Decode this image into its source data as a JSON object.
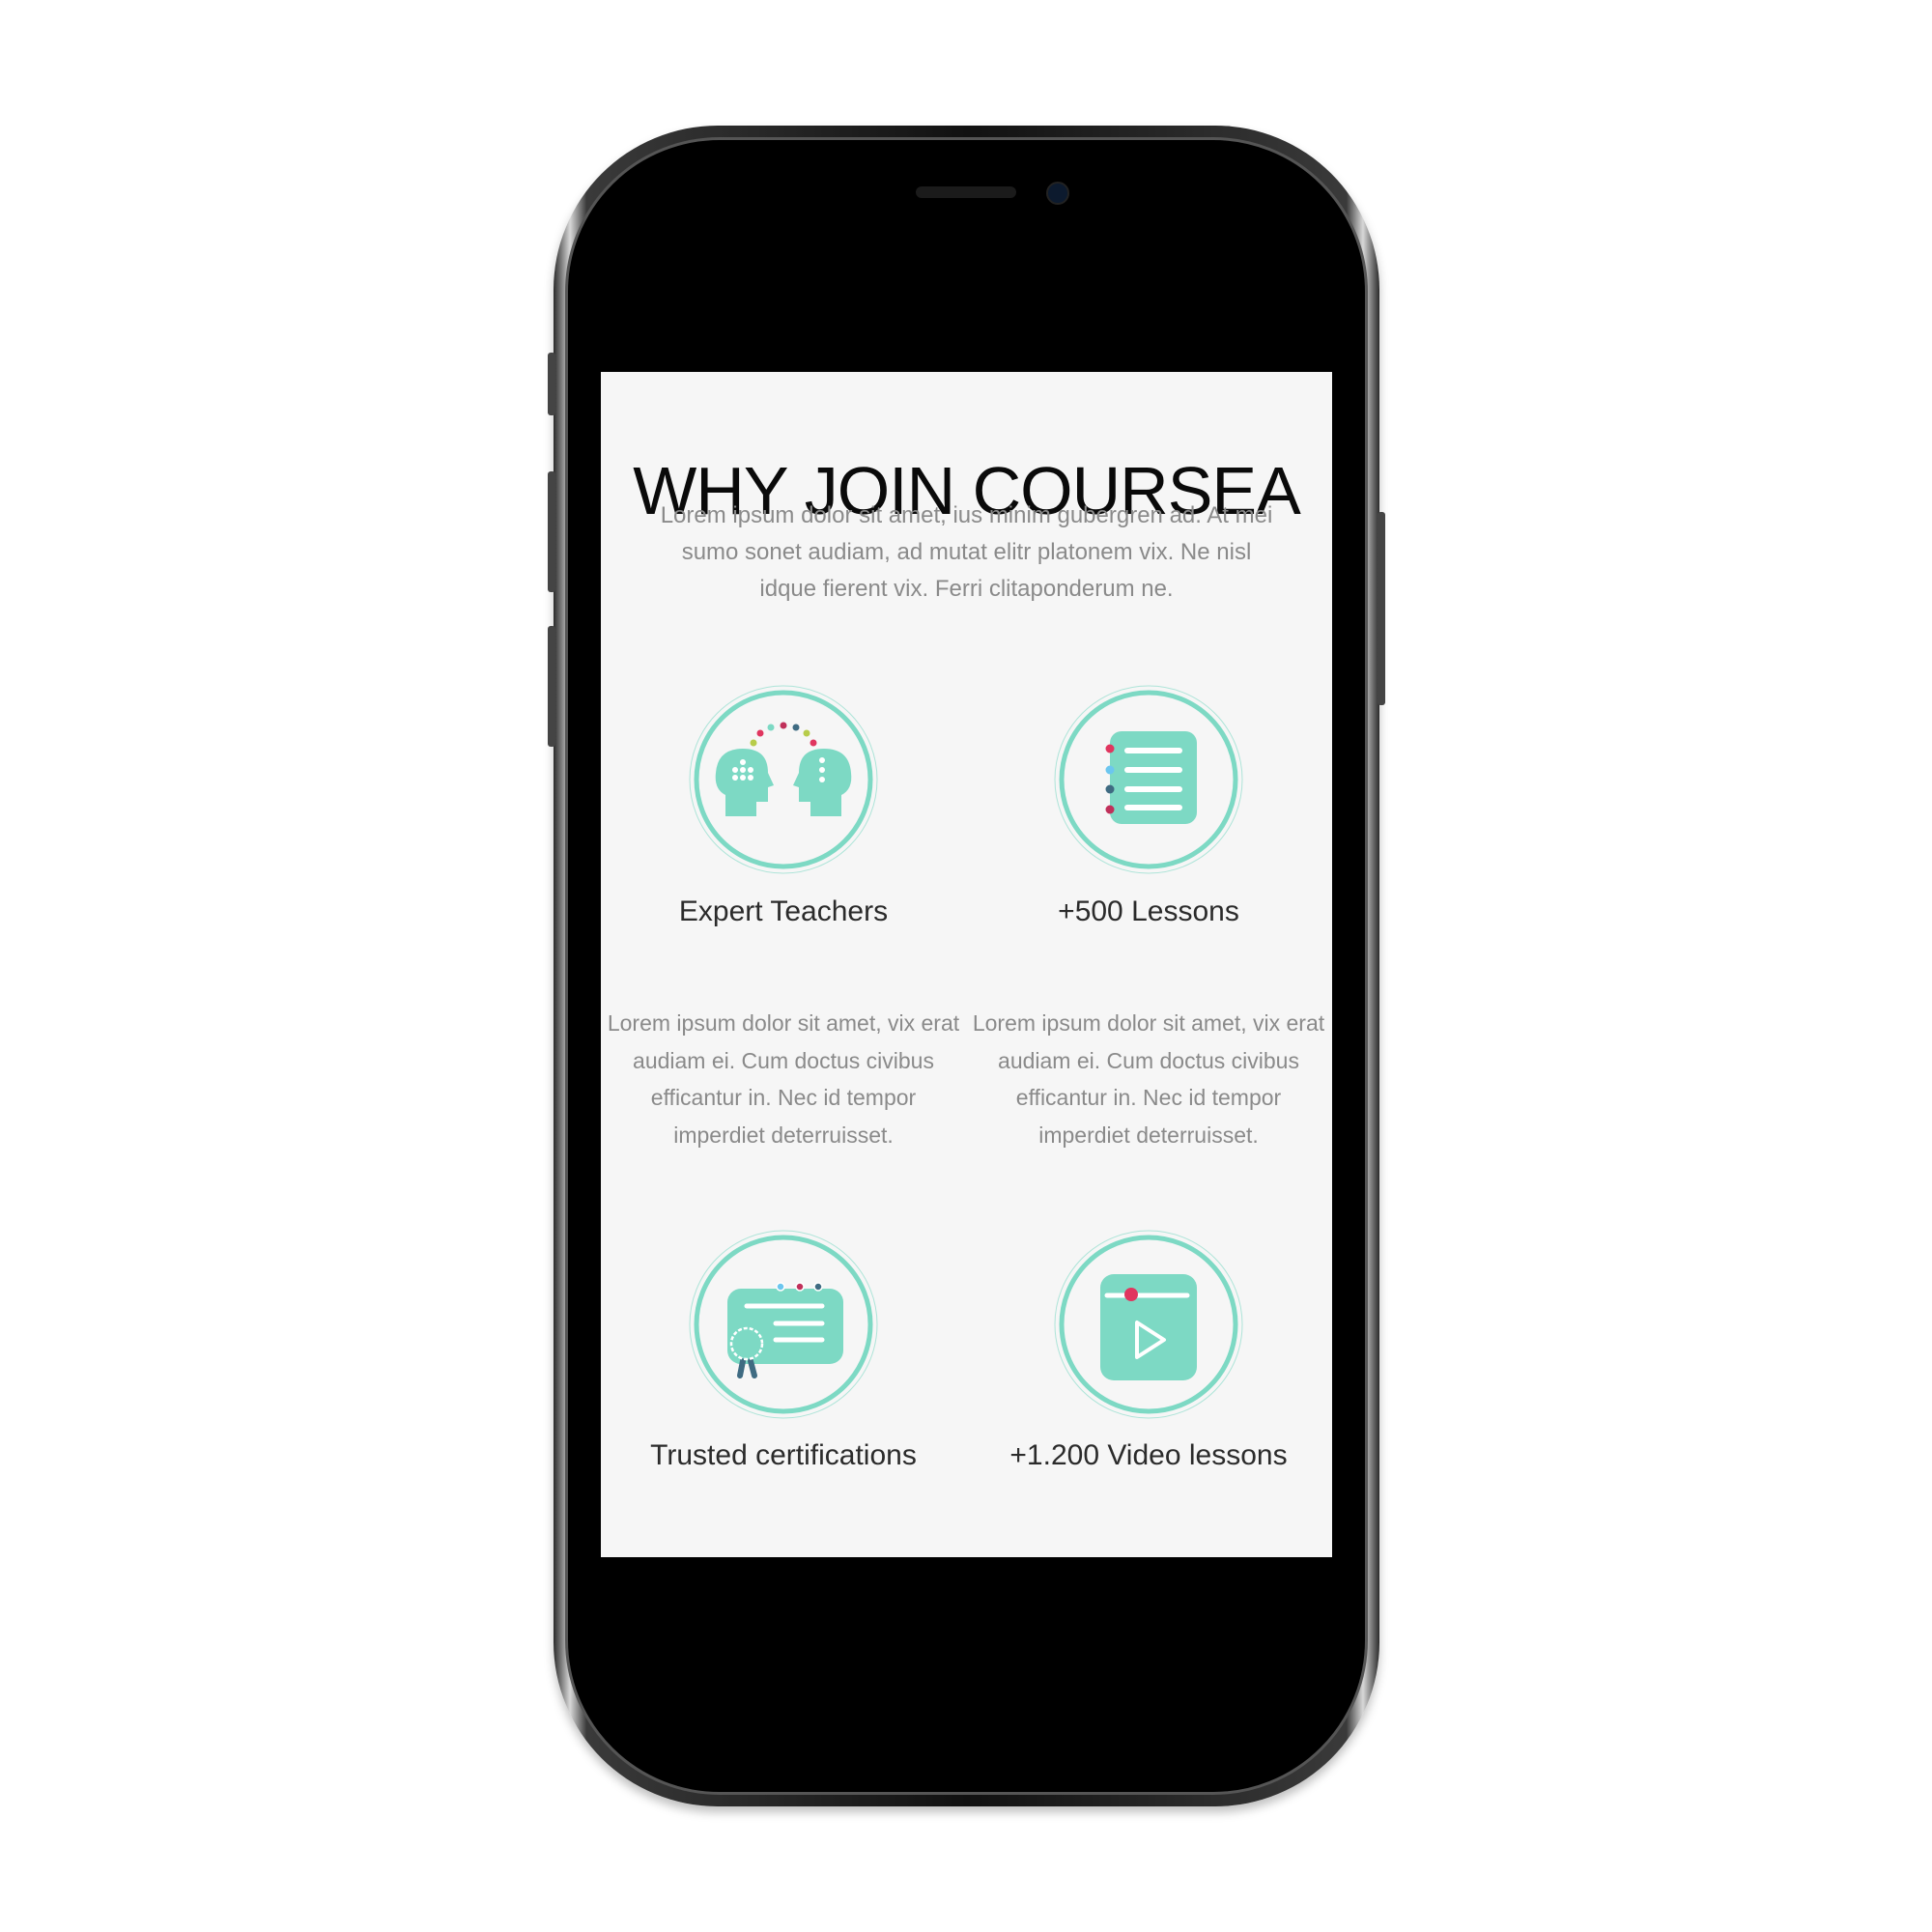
{
  "header": {
    "title": "WHY JOIN COURSEA",
    "intro": "Lorem ipsum dolor sit amet, ius minim gubergren ad. At mei sumo sonet audiam, ad mutat elitr platonem vix. Ne nisl idque fierent vix. Ferri clitaponderum ne."
  },
  "features": [
    {
      "title": "Expert Teachers",
      "icon": "teachers-heads-icon",
      "description": "Lorem ipsum dolor sit amet, vix erat audiam ei. Cum doctus civibus efficantur in. Nec id tempor imperdiet deterruisset."
    },
    {
      "title": "+500 Lessons",
      "icon": "lessons-notebook-icon",
      "description": "Lorem ipsum dolor sit amet, vix erat audiam ei. Cum doctus civibus efficantur in. Nec id tempor imperdiet deterruisset."
    },
    {
      "title": "Trusted certifications",
      "icon": "certificate-icon"
    },
    {
      "title": "+1.200 Video lessons",
      "icon": "video-player-icon"
    }
  ],
  "colors": {
    "accent": "#7dd9c4",
    "pink": "#e0365f",
    "blue": "#6cc6ef",
    "navy": "#3f6b82",
    "lime": "#b7cc4a",
    "background": "#f6f6f6"
  }
}
